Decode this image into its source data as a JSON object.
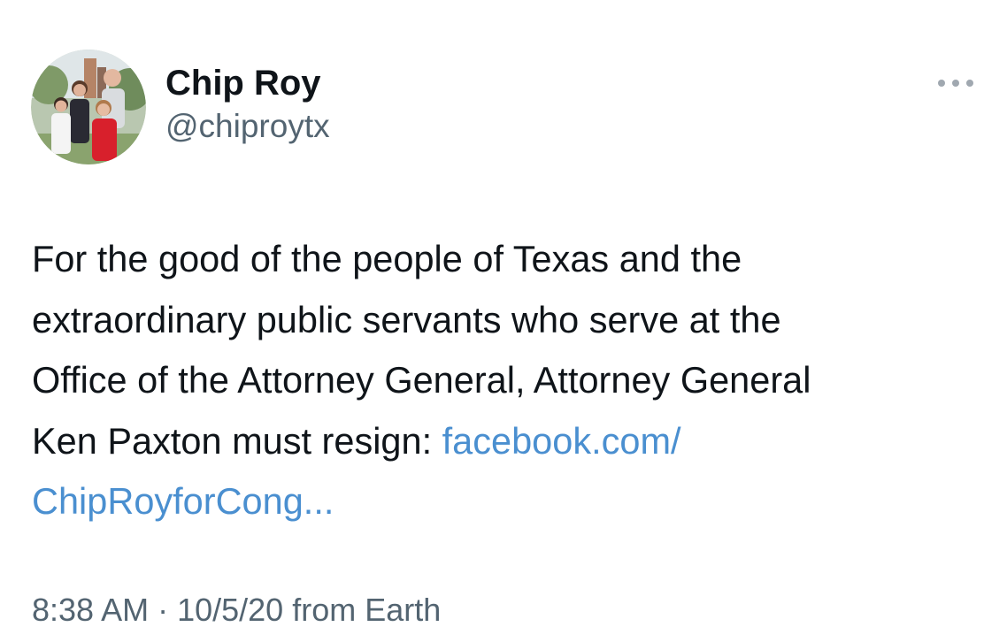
{
  "author": {
    "display_name": "Chip Roy",
    "handle": "@chiproytx"
  },
  "icons": {
    "avatar": "profile-photo",
    "more": "more-horizontal-icon"
  },
  "tweet": {
    "text_lines": [
      "For the good of the people of Texas and the",
      "extraordinary public servants who serve at the",
      "Office of the Attorney General, Attorney General",
      "Ken Paxton must resign: "
    ],
    "link_part1": "facebook.com/",
    "link_part2": "ChipRoyforCong..."
  },
  "meta": {
    "time": "8:38 AM",
    "separator": " · ",
    "date": "10/5/20",
    "source": " from Earth"
  },
  "colors": {
    "link": "#4a8fd0",
    "secondary_text": "#536471",
    "primary_text": "#0f1419"
  }
}
